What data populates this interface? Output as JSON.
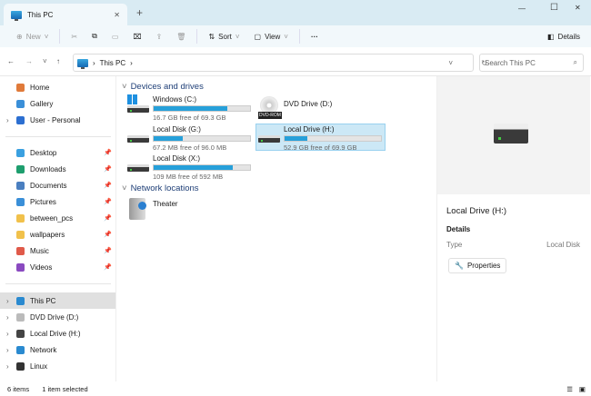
{
  "window": {
    "tab_title": "This PC",
    "new_tab": "+",
    "min": "—",
    "max": "☐",
    "close": "✕"
  },
  "toolbar": {
    "new": "New",
    "sort": "Sort",
    "view": "View",
    "more": "···",
    "details": "Details"
  },
  "address": {
    "path": "This PC",
    "search_placeholder": "Search This PC"
  },
  "sidebar": {
    "items": [
      {
        "label": "Home",
        "color": "#e07a3a"
      },
      {
        "label": "Gallery",
        "color": "#3a8fd8"
      },
      {
        "label": "User - Personal",
        "color": "#2c6fd1"
      },
      {
        "label": "Desktop",
        "color": "#3aa0e0"
      },
      {
        "label": "Downloads",
        "color": "#1e9e6e"
      },
      {
        "label": "Documents",
        "color": "#4a7fc0"
      },
      {
        "label": "Pictures",
        "color": "#3a8fd8"
      },
      {
        "label": "between_pcs",
        "color": "#f1c14b"
      },
      {
        "label": "wallpapers",
        "color": "#f1c14b"
      },
      {
        "label": "Music",
        "color": "#e05a4a"
      },
      {
        "label": "Videos",
        "color": "#8a4ac0"
      },
      {
        "label": "This PC",
        "color": "#2a8ad0"
      },
      {
        "label": "DVD Drive (D:)",
        "color": "#bbbbbb"
      },
      {
        "label": "Local Drive (H:)",
        "color": "#444444"
      },
      {
        "label": "Network",
        "color": "#2a8ad0"
      },
      {
        "label": "Linux",
        "color": "#333333"
      }
    ]
  },
  "content": {
    "devices_header": "Devices and drives",
    "network_header": "Network locations",
    "drives": [
      {
        "name": "Windows (C:)",
        "free": "16.7 GB free of 69.3 GB",
        "used_fraction": 0.76
      },
      {
        "name": "DVD Drive (D:)",
        "badge": "DVD-ROM"
      },
      {
        "name": "Local Disk (G:)",
        "free": "67.2 MB free of 96.0 MB",
        "used_fraction": 0.3
      },
      {
        "name": "Local Drive (H:)",
        "free": "52.9 GB free of 69.9 GB",
        "used_fraction": 0.24
      },
      {
        "name": "Local Disk (X:)",
        "free": "109 MB free of 592 MB",
        "used_fraction": 0.82
      }
    ],
    "network": [
      {
        "name": "Theater"
      }
    ]
  },
  "details": {
    "title": "Local Drive (H:)",
    "section": "Details",
    "type_label": "Type",
    "type_value": "Local Disk",
    "properties": "Properties"
  },
  "status": {
    "items": "6 items",
    "selected": "1 item selected"
  }
}
